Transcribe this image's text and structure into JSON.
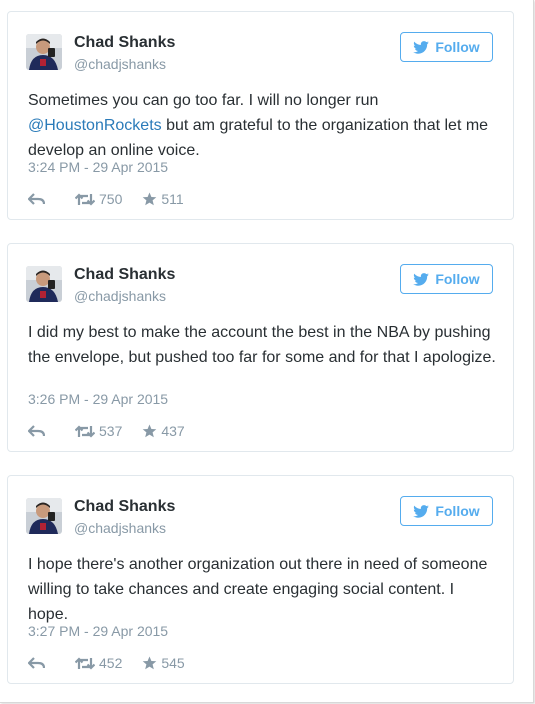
{
  "colors": {
    "twitter_blue": "#55acee",
    "link_blue": "#2b7bb9",
    "text": "#292f33",
    "muted": "#8899a6"
  },
  "tweets": [
    {
      "name": "Chad Shanks",
      "handle": "@chadjshanks",
      "follow_label": "Follow",
      "text_before": "Sometimes you can go too far. I will no longer run ",
      "mention": "@HoustonRockets",
      "text_after": " but am grateful to the organization that let me develop an online voice.",
      "timestamp": "3:24 PM - 29 Apr 2015",
      "retweets": "750",
      "favorites": "511"
    },
    {
      "name": "Chad Shanks",
      "handle": "@chadjshanks",
      "follow_label": "Follow",
      "text_before": "I did my best to make the account the best in the NBA by pushing the envelope, but pushed too far for some and for that I apologize.",
      "mention": "",
      "text_after": "",
      "timestamp": "3:26 PM - 29 Apr 2015",
      "retweets": "537",
      "favorites": "437"
    },
    {
      "name": "Chad Shanks",
      "handle": "@chadjshanks",
      "follow_label": "Follow",
      "text_before": "I hope there's another organization out there in need of someone willing to take chances and create engaging social content. I hope.",
      "mention": "",
      "text_after": "",
      "timestamp": "3:27 PM - 29 Apr 2015",
      "retweets": "452",
      "favorites": "545"
    }
  ],
  "icons": {
    "avatar": "avatar",
    "bird": "twitter-bird-icon",
    "reply": "reply-icon",
    "retweet": "retweet-icon",
    "favorite": "star-icon"
  }
}
